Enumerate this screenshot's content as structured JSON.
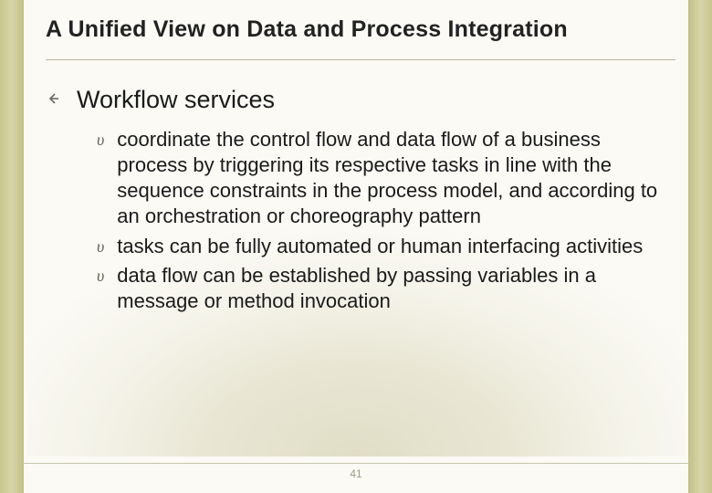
{
  "title": "A Unified View on Data and Process Integration",
  "main": {
    "heading": "Workflow services",
    "bullets": [
      "coordinate the control flow and data flow of a business process by triggering its respective tasks in line with the sequence constraints in the process model, and according to an orchestration or choreography pattern",
      "tasks can be fully automated or human interfacing activities",
      "data flow can be established by passing variables in a message or method invocation"
    ]
  },
  "page_number": "41"
}
